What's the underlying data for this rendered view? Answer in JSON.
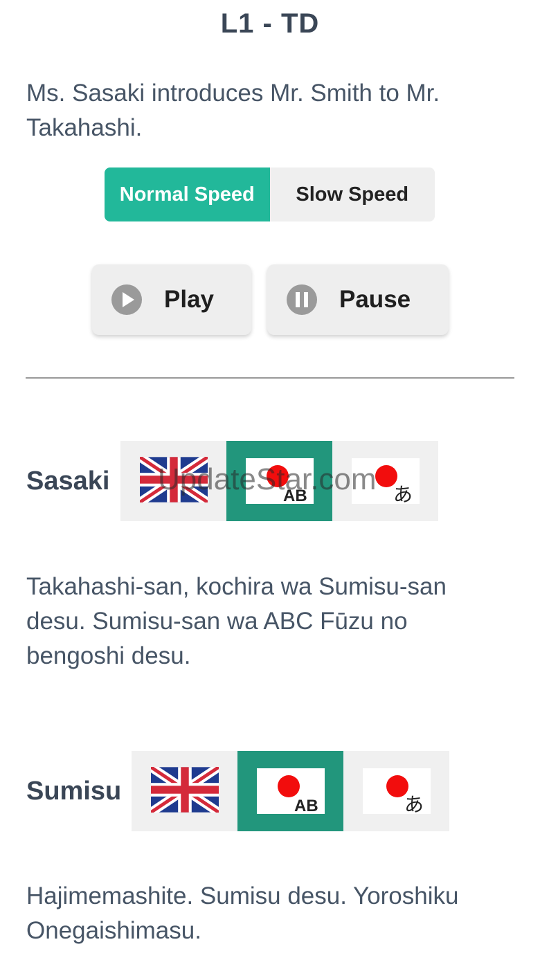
{
  "header": {
    "title": "L1 - TD"
  },
  "description": "Ms. Sasaki introduces Mr. Smith to Mr. Takahashi.",
  "speed": {
    "options": [
      "Normal Speed",
      "Slow Speed"
    ],
    "selected": "Normal Speed"
  },
  "controls": {
    "play_label": "Play",
    "pause_label": "Pause"
  },
  "dialogue": [
    {
      "speaker": "Sasaki",
      "selected_mode": "romaji",
      "modes": [
        "english-flag-icon",
        "romaji-flag-icon",
        "hiragana-flag-icon"
      ],
      "text": "Takahashi-san, kochira wa Sumisu-san desu. Sumisu-san wa ABC Fūzu no bengoshi desu."
    },
    {
      "speaker": "Sumisu",
      "selected_mode": "romaji",
      "modes": [
        "english-flag-icon",
        "romaji-flag-icon",
        "hiragana-flag-icon"
      ],
      "text": "Hajimemashite. Sumisu desu. Yoroshiku Onegaishimasu."
    }
  ],
  "icon_labels": {
    "romaji": "AB",
    "hiragana": "あ"
  },
  "watermark": "UpdateStar.com",
  "colors": {
    "accent": "#22b89a",
    "selected_lang": "#22967c",
    "text": "#475566"
  }
}
